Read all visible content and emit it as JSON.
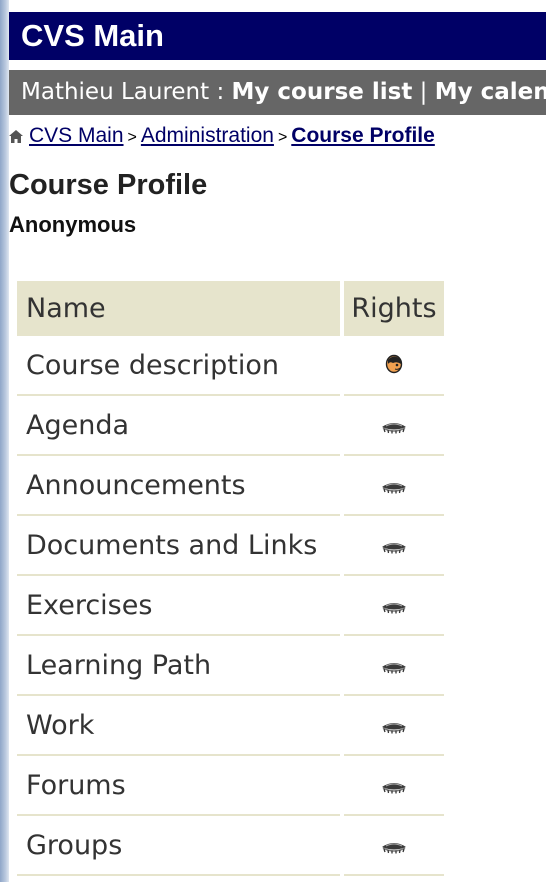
{
  "header": {
    "title": "CVS Main"
  },
  "user_bar": {
    "user_name": "Mathieu Laurent",
    "separator": " : ",
    "links": [
      "My course list",
      "My calendar"
    ],
    "link_separator": " | "
  },
  "breadcrumb": {
    "items": [
      "CVS Main",
      "Administration",
      "Course Profile"
    ],
    "separator": ">"
  },
  "page": {
    "title": "Course Profile",
    "subtitle": "Anonymous"
  },
  "table": {
    "headers": {
      "name": "Name",
      "rights": "Rights"
    },
    "rows": [
      {
        "name": "Course description",
        "right": "user-face-icon"
      },
      {
        "name": "Agenda",
        "right": "eye-closed-icon"
      },
      {
        "name": "Announcements",
        "right": "eye-closed-icon"
      },
      {
        "name": "Documents and Links",
        "right": "eye-closed-icon"
      },
      {
        "name": "Exercises",
        "right": "eye-closed-icon"
      },
      {
        "name": "Learning Path",
        "right": "eye-closed-icon"
      },
      {
        "name": "Work",
        "right": "eye-closed-icon"
      },
      {
        "name": "Forums",
        "right": "eye-closed-icon"
      },
      {
        "name": "Groups",
        "right": "eye-closed-icon"
      }
    ]
  },
  "colors": {
    "header_bg": "#000066",
    "user_bar_bg": "#666666",
    "table_header_bg": "#e6e4cc"
  }
}
